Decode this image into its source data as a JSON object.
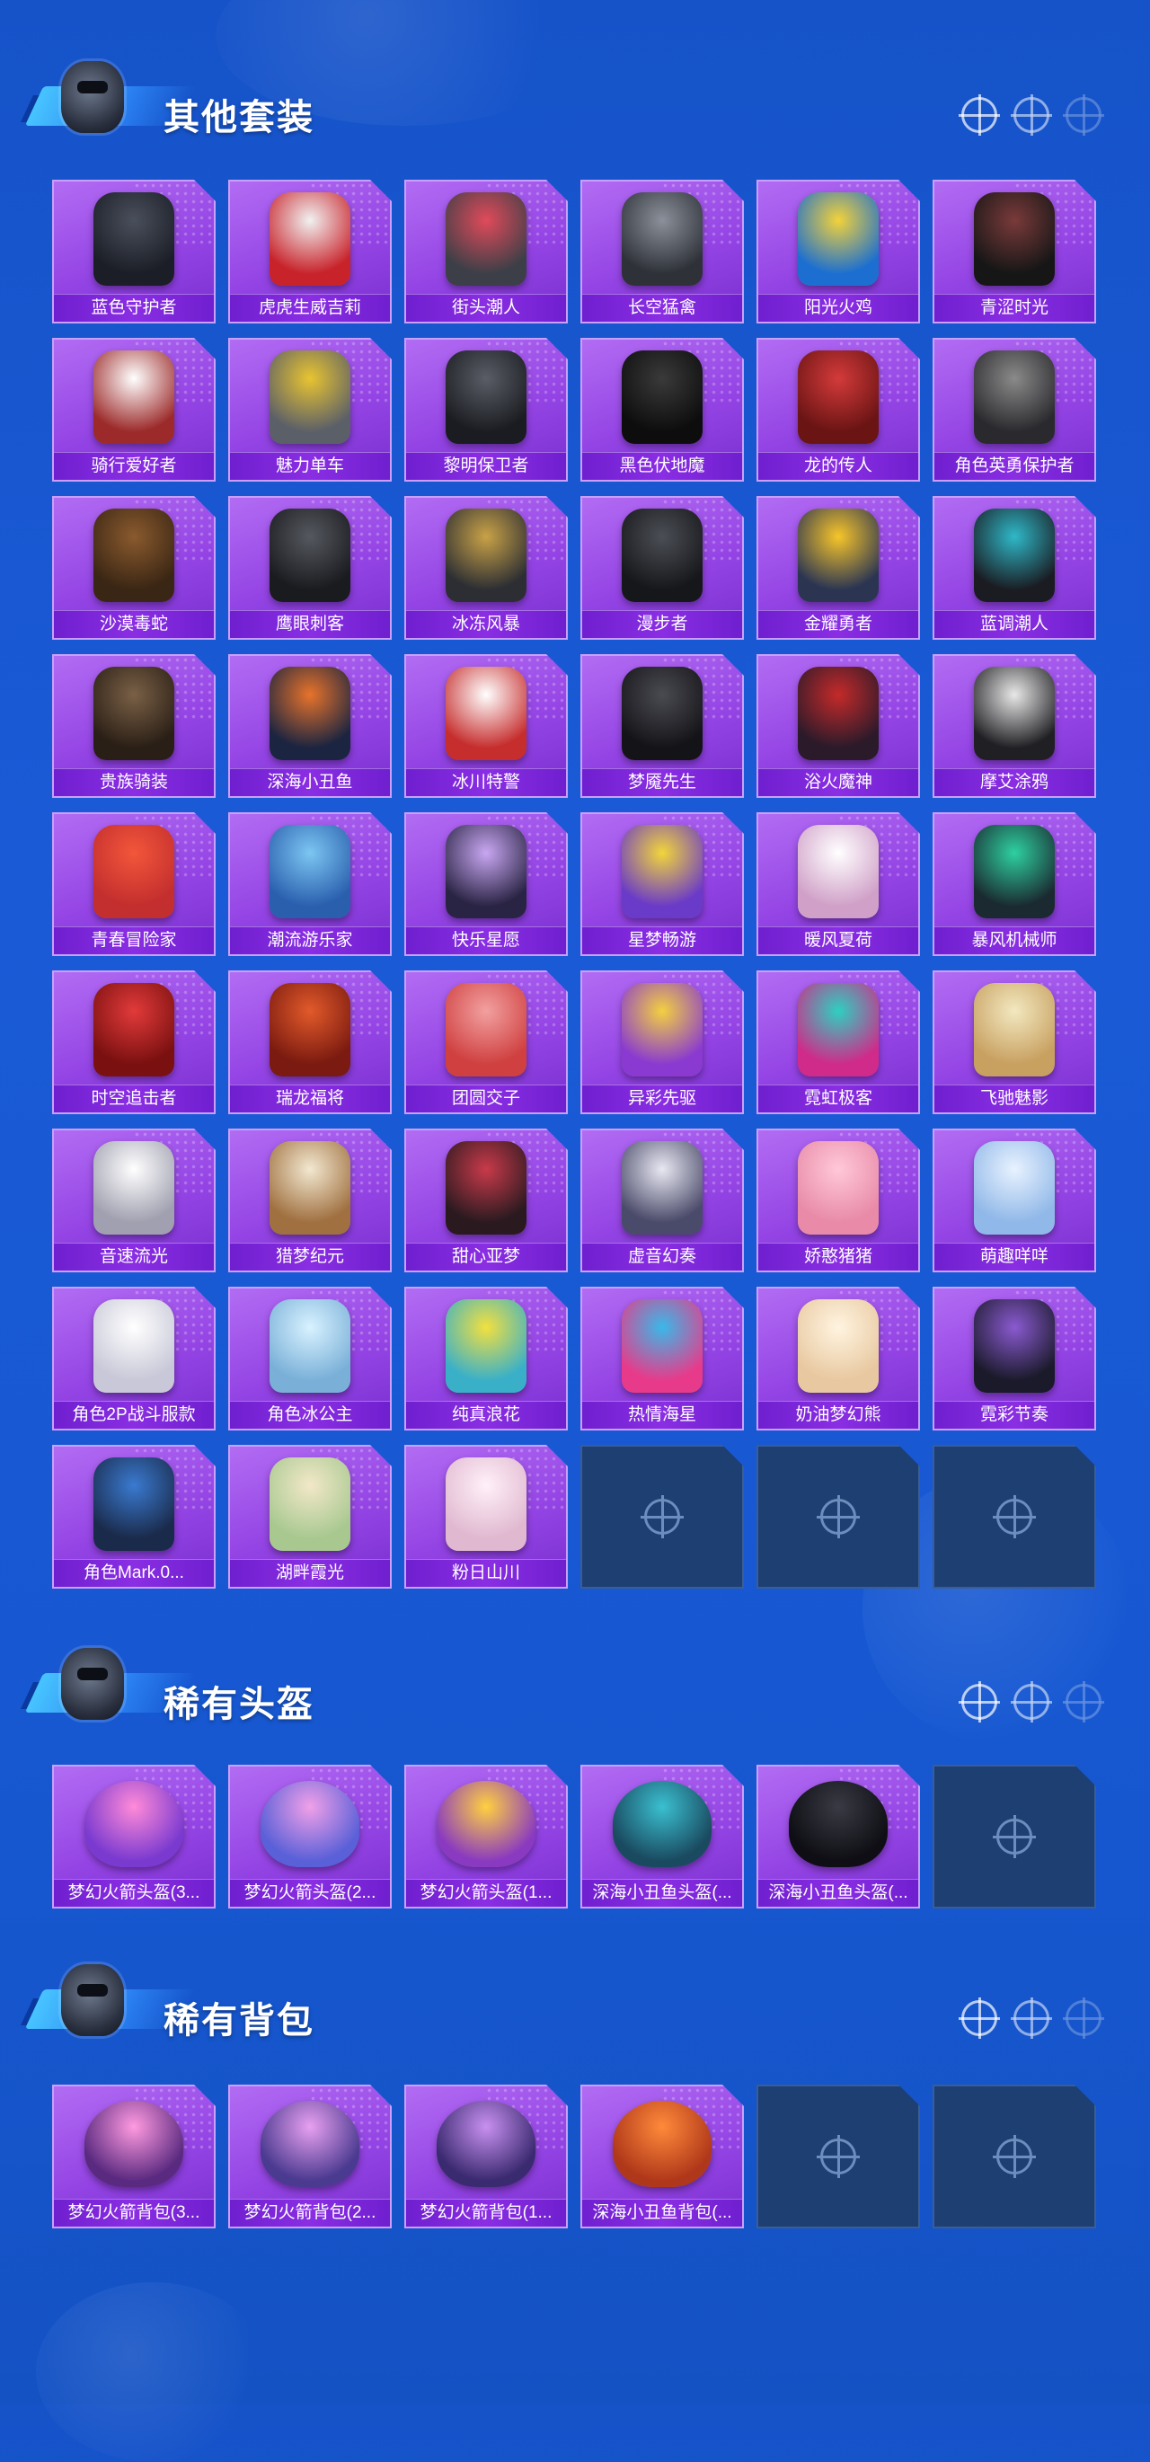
{
  "sections": [
    {
      "title": "其他套装",
      "items": [
        {
          "label": "蓝色守护者",
          "c1": "#4a4f5c",
          "c2": "#1b1e26"
        },
        {
          "label": "虎虎生威吉莉",
          "c1": "#f1f1f1",
          "c2": "#c8232b"
        },
        {
          "label": "街头潮人",
          "c1": "#e04a5a",
          "c2": "#3c3f47"
        },
        {
          "label": "长空猛禽",
          "c1": "#8b909a",
          "c2": "#2e3138"
        },
        {
          "label": "阳光火鸡",
          "c1": "#f3d23a",
          "c2": "#1c6fd0"
        },
        {
          "label": "青涩时光",
          "c1": "#7a3a3a",
          "c2": "#161616"
        },
        {
          "label": "骑行爱好者",
          "c1": "#ffffff",
          "c2": "#9c2a2a"
        },
        {
          "label": "魅力单车",
          "c1": "#e8c431",
          "c2": "#5b5f68"
        },
        {
          "label": "黎明保卫者",
          "c1": "#5a5d66",
          "c2": "#1a1c21"
        },
        {
          "label": "黑色伏地魔",
          "c1": "#3a3a3a",
          "c2": "#0d0d0d"
        },
        {
          "label": "龙的传人",
          "c1": "#d43a3a",
          "c2": "#6a1414"
        },
        {
          "label": "角色英勇保护者",
          "c1": "#8a8a8a",
          "c2": "#2a2a2e"
        },
        {
          "label": "沙漠毒蛇",
          "c1": "#8a5a2e",
          "c2": "#3a2614"
        },
        {
          "label": "鹰眼刺客",
          "c1": "#55585f",
          "c2": "#1a1b1f"
        },
        {
          "label": "冰冻风暴",
          "c1": "#c9a247",
          "c2": "#2c2e33"
        },
        {
          "label": "漫步者",
          "c1": "#4b4e55",
          "c2": "#16171a"
        },
        {
          "label": "金耀勇者",
          "c1": "#f7c52a",
          "c2": "#2b3552"
        },
        {
          "label": "蓝调潮人",
          "c1": "#2fb8c8",
          "c2": "#1a1c22"
        },
        {
          "label": "贵族骑装",
          "c1": "#7a6046",
          "c2": "#2a1f16"
        },
        {
          "label": "深海小丑鱼",
          "c1": "#e7732b",
          "c2": "#1b2440"
        },
        {
          "label": "冰川特警",
          "c1": "#ffffff",
          "c2": "#c62d2d"
        },
        {
          "label": "梦魇先生",
          "c1": "#4a4a52",
          "c2": "#141418"
        },
        {
          "label": "浴火魔神",
          "c1": "#c42a2a",
          "c2": "#2a1a2a"
        },
        {
          "label": "摩艾涂鸦",
          "c1": "#e8e8e8",
          "c2": "#202024"
        },
        {
          "label": "青春冒险家",
          "c1": "#f2563a",
          "c2": "#c32e2e"
        },
        {
          "label": "潮流游乐家",
          "c1": "#7cc6f2",
          "c2": "#2a5fae"
        },
        {
          "label": "快乐星愿",
          "c1": "#c8a7f2",
          "c2": "#2a2444"
        },
        {
          "label": "星梦畅游",
          "c1": "#f2d53a",
          "c2": "#6a3ac8"
        },
        {
          "label": "暖风夏荷",
          "c1": "#ffffff",
          "c2": "#d0a0c8"
        },
        {
          "label": "暴风机械师",
          "c1": "#2ed0a0",
          "c2": "#1a2a30"
        },
        {
          "label": "时空追击者",
          "c1": "#e23a3a",
          "c2": "#7a1010"
        },
        {
          "label": "瑞龙福将",
          "c1": "#e25a2a",
          "c2": "#7a1a10"
        },
        {
          "label": "团圆交子",
          "c1": "#f2a0a0",
          "c2": "#d04040"
        },
        {
          "label": "异彩先驱",
          "c1": "#f2d040",
          "c2": "#8a3ad0"
        },
        {
          "label": "霓虹极客",
          "c1": "#2ed0c0",
          "c2": "#d02a8a"
        },
        {
          "label": "飞驰魅影",
          "c1": "#f2e8c0",
          "c2": "#c8a060"
        },
        {
          "label": "音速流光",
          "c1": "#ffffff",
          "c2": "#a0a0b0"
        },
        {
          "label": "猎梦纪元",
          "c1": "#f2e8d0",
          "c2": "#a07040"
        },
        {
          "label": "甜心亚梦",
          "c1": "#c83a4a",
          "c2": "#2a1a20"
        },
        {
          "label": "虚音幻奏",
          "c1": "#e8e8f2",
          "c2": "#4a4a6a"
        },
        {
          "label": "娇憨猪猪",
          "c1": "#ffc8d8",
          "c2": "#e88aa8"
        },
        {
          "label": "萌趣咩咩",
          "c1": "#e8f2ff",
          "c2": "#90b8e8"
        },
        {
          "label": "角色2P战斗服款",
          "c1": "#ffffff",
          "c2": "#c8c8d8"
        },
        {
          "label": "角色冰公主",
          "c1": "#d8f2ff",
          "c2": "#7ab0d8"
        },
        {
          "label": "纯真浪花",
          "c1": "#f2e040",
          "c2": "#3ab0c8"
        },
        {
          "label": "热情海星",
          "c1": "#3ab8e8",
          "c2": "#e83a8a"
        },
        {
          "label": "奶油梦幻熊",
          "c1": "#fff4e0",
          "c2": "#e8c8a0"
        },
        {
          "label": "霓彩节奏",
          "c1": "#8a5ad0",
          "c2": "#1a1a2a"
        },
        {
          "label": "角色Mark.0...",
          "c1": "#3a7ad0",
          "c2": "#1a2a4a"
        },
        {
          "label": "湖畔霞光",
          "c1": "#f2e8c8",
          "c2": "#a8c890"
        },
        {
          "label": "粉日山川",
          "c1": "#fff0f8",
          "c2": "#e0b8d0"
        }
      ],
      "empty_slots": 3
    },
    {
      "title": "稀有头盔",
      "items": [
        {
          "label": "梦幻火箭头盔(3...",
          "c1": "#ff8ad8",
          "c2": "#7a3ad0"
        },
        {
          "label": "梦幻火箭头盔(2...",
          "c1": "#f0a0e8",
          "c2": "#5a60d8"
        },
        {
          "label": "梦幻火箭头盔(1...",
          "c1": "#ffd040",
          "c2": "#8a3ac0"
        },
        {
          "label": "深海小丑鱼头盔(...",
          "c1": "#3ac0d0",
          "c2": "#1a4a60"
        },
        {
          "label": "深海小丑鱼头盔(...",
          "c1": "#3a3a44",
          "c2": "#0e0e14"
        }
      ],
      "empty_slots": 1
    },
    {
      "title": "稀有背包",
      "items": [
        {
          "label": "梦幻火箭背包(3...",
          "c1": "#ff9ae0",
          "c2": "#5a2a80"
        },
        {
          "label": "梦幻火箭背包(2...",
          "c1": "#e8a0f0",
          "c2": "#4a3a90"
        },
        {
          "label": "梦幻火箭背包(1...",
          "c1": "#c890f0",
          "c2": "#3a2a70"
        },
        {
          "label": "深海小丑鱼背包(...",
          "c1": "#ff8a3a",
          "c2": "#b0381a"
        }
      ],
      "empty_slots": 2
    }
  ]
}
